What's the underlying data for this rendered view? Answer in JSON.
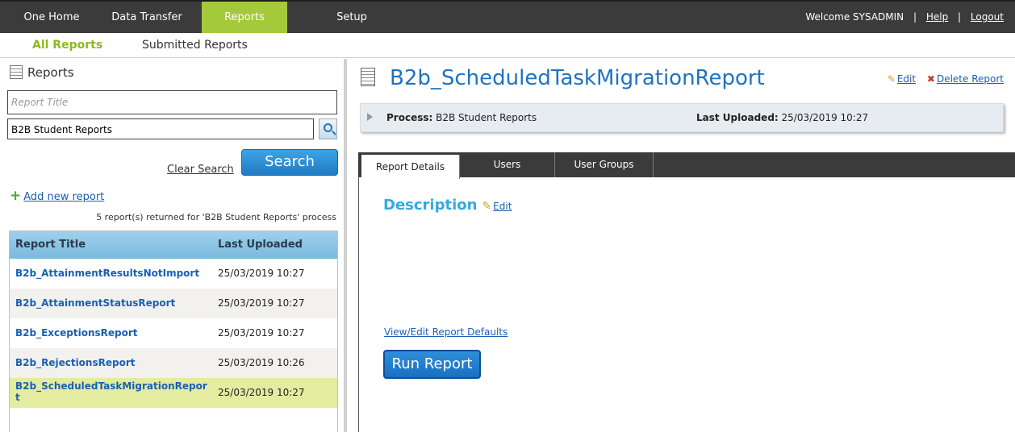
{
  "nav": {
    "items": [
      "One Home",
      "Data Transfer",
      "Reports",
      "Setup"
    ],
    "welcome": "Welcome  SYSADMIN",
    "sep": "|",
    "help": "Help",
    "logout": "Logout"
  },
  "subnav": {
    "all_reports": "All Reports",
    "submitted_reports": "Submitted Reports"
  },
  "left": {
    "title": "Reports",
    "report_title_placeholder": "Report Title",
    "process_value": "B2B Student Reports",
    "clear_search": "Clear Search",
    "search_button": "Search",
    "add_new": "Add new report",
    "count_text": "5 report(s) returned for 'B2B Student Reports' process",
    "table": {
      "headers": [
        "Report Title",
        "Last Uploaded"
      ],
      "rows": [
        {
          "title": "B2b_AttainmentResultsNotImport",
          "date": "25/03/2019 10:27"
        },
        {
          "title": "B2b_AttainmentStatusReport",
          "date": "25/03/2019 10:27"
        },
        {
          "title": "B2b_ExceptionsReport",
          "date": "25/03/2019 10:27"
        },
        {
          "title": "B2b_RejectionsReport",
          "date": "25/03/2019 10:26"
        },
        {
          "title": "B2b_ScheduledTaskMigrationReport",
          "date": "25/03/2019 10:27"
        }
      ]
    }
  },
  "right": {
    "title": "B2b_ScheduledTaskMigrationReport",
    "edit": "Edit",
    "delete": "Delete Report",
    "process_label": "Process:",
    "process_value": "B2B Student Reports",
    "uploaded_label": "Last Uploaded:",
    "uploaded_value": "25/03/2019 10:27",
    "tabs": [
      "Report Details",
      "Users",
      "User Groups"
    ],
    "description_title": "Description",
    "description_edit": "Edit",
    "view_edit_defaults": "View/Edit Report Defaults",
    "run_report": "Run Report"
  },
  "colors": {
    "nav_bg": "#3b3b3b",
    "nav_active": "#a4c93b",
    "link": "#1a5fb4",
    "accent_blue": "#1f72c1",
    "selected_row": "#e3ec9f"
  }
}
